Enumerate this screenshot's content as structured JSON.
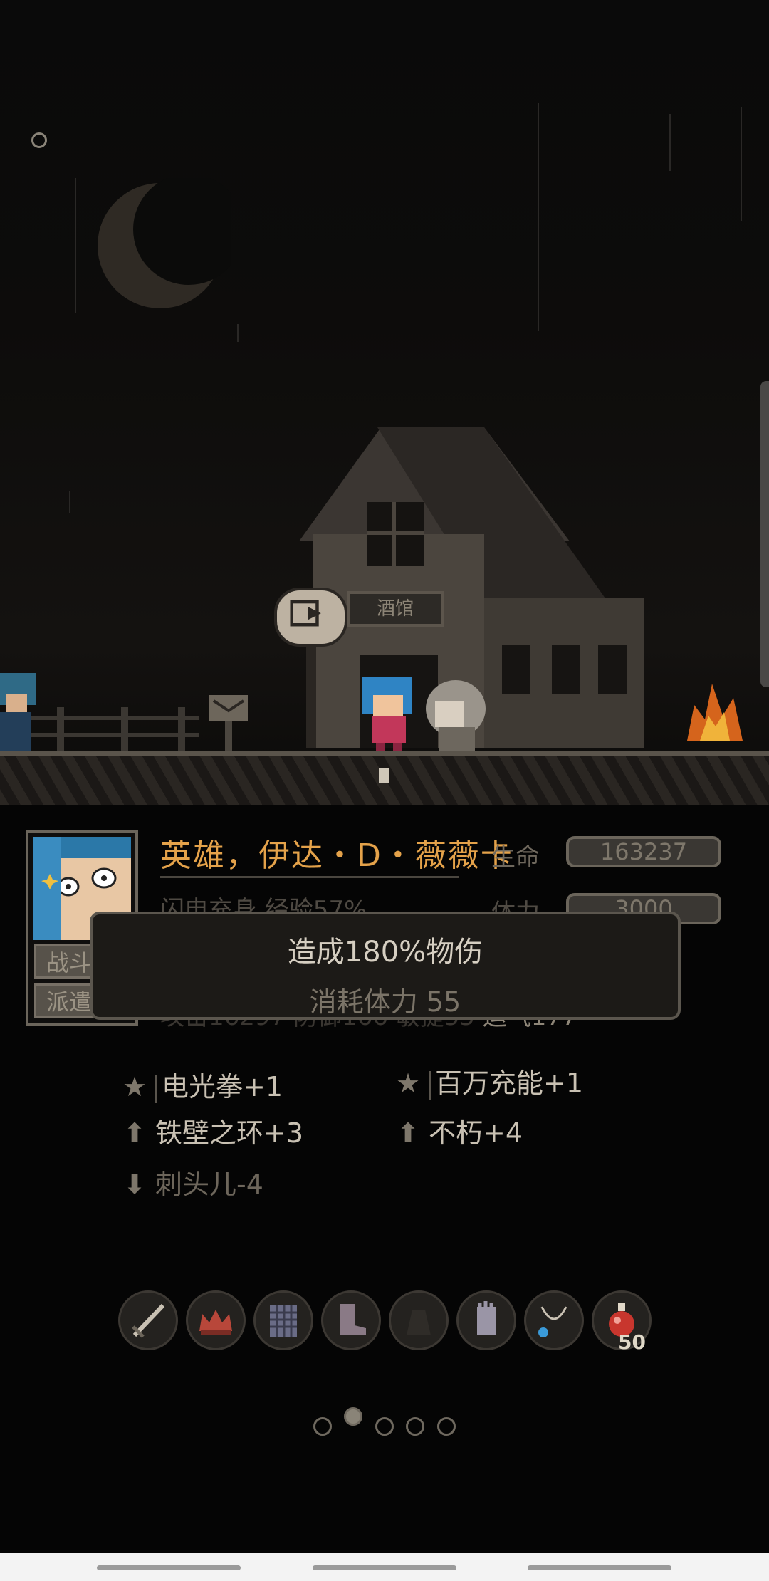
{
  "hero": {
    "name": "英雄，伊达・D・薇薇卡",
    "life_label": "生命",
    "life_value": "163237",
    "sub_line": "闪电充身  经验57%",
    "stamina_label": "体力",
    "stamina_value": "3000",
    "stats_line_a": "攻击16297  防御166  敏捷55  ",
    "stats_line_b": "运气177",
    "side_buttons": [
      "战斗",
      "派遣"
    ]
  },
  "tooltip": {
    "line1": "造成180%物伤",
    "line2": "消耗体力 55"
  },
  "skills": [
    {
      "icon": "star-icon",
      "label": "电光拳+1"
    },
    {
      "icon": "star-icon",
      "label": "百万充能+1"
    },
    {
      "icon": "arrow-up-icon",
      "label": "铁壁之环+3"
    },
    {
      "icon": "arrow-up-icon",
      "label": "不朽+4"
    },
    {
      "icon": "arrow-down-icon",
      "label": "刺头儿-4"
    }
  ],
  "inventory": {
    "items": [
      "sword-icon",
      "crown-icon",
      "chainmail-icon",
      "boots-icon",
      "empty-slot-icon",
      "gloves-icon",
      "necklace-icon",
      "potion-icon"
    ],
    "potion_count": "50"
  },
  "scene": {
    "tavern_sign": "酒馆"
  },
  "pager": {
    "count": 5,
    "active_index": 1
  }
}
